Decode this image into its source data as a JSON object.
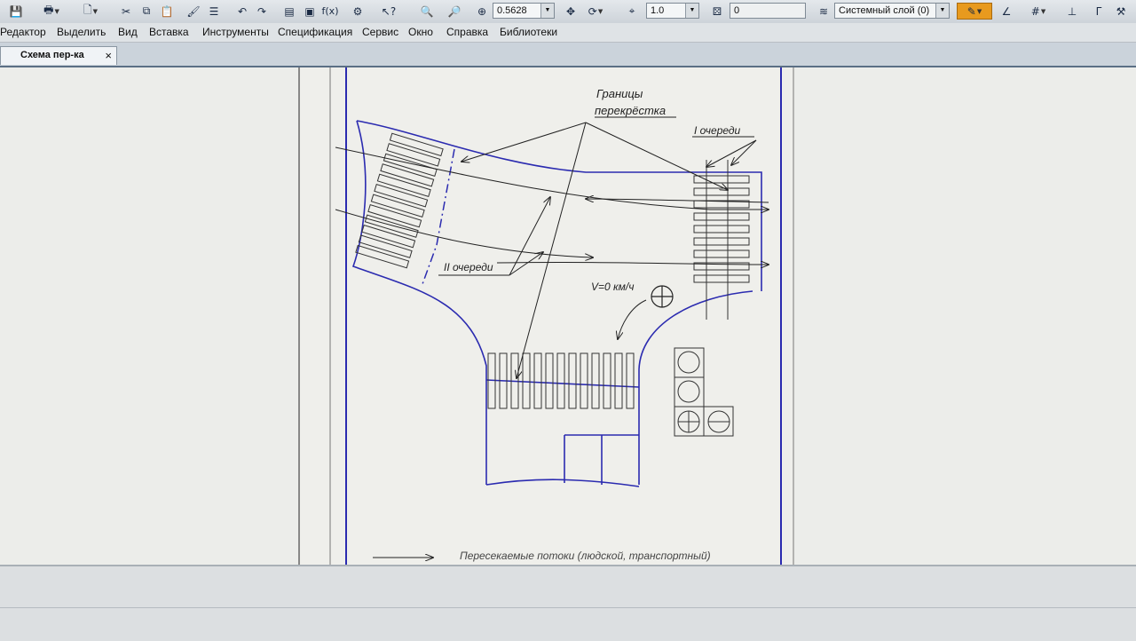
{
  "toolbar": {
    "zoom_value": "0.5628",
    "line_scale": "1.0",
    "step_value": "0",
    "layer": "Системный слой (0)",
    "accent": "#e89a1e",
    "icons": [
      "save-icon",
      "print-icon",
      "preview-icon",
      "cut-icon",
      "copy-icon",
      "paste-icon",
      "format-brush-icon",
      "properties-icon",
      "undo-icon",
      "redo-icon",
      "manager-icon",
      "library-icon",
      "fx-icon",
      "variables-icon",
      "help-icon",
      "zoom-icon",
      "zoom-window-icon",
      "zoom-scale-icon",
      "pan-icon",
      "refresh-icon",
      "snap-icon",
      "layers-icon",
      "style-icon",
      "grid-icon",
      "axis-icon",
      "rounding-icon"
    ]
  },
  "menu": [
    "Редактор",
    "Выделить",
    "Вид",
    "Вставка",
    "Инструменты",
    "Спецификация",
    "Сервис",
    "Окно",
    "Справка",
    "Библиотеки"
  ],
  "tab": {
    "label": "Схема пер-ка",
    "close": "×"
  },
  "drawing": {
    "label_borders": [
      "Границы",
      "перекрёстка"
    ],
    "label_queue1": "I очереди",
    "label_queue2": "II очереди",
    "label_speed": "V=0 км/ч",
    "legend_text": "Пересекаемые потоки (людской, транспортный)"
  }
}
